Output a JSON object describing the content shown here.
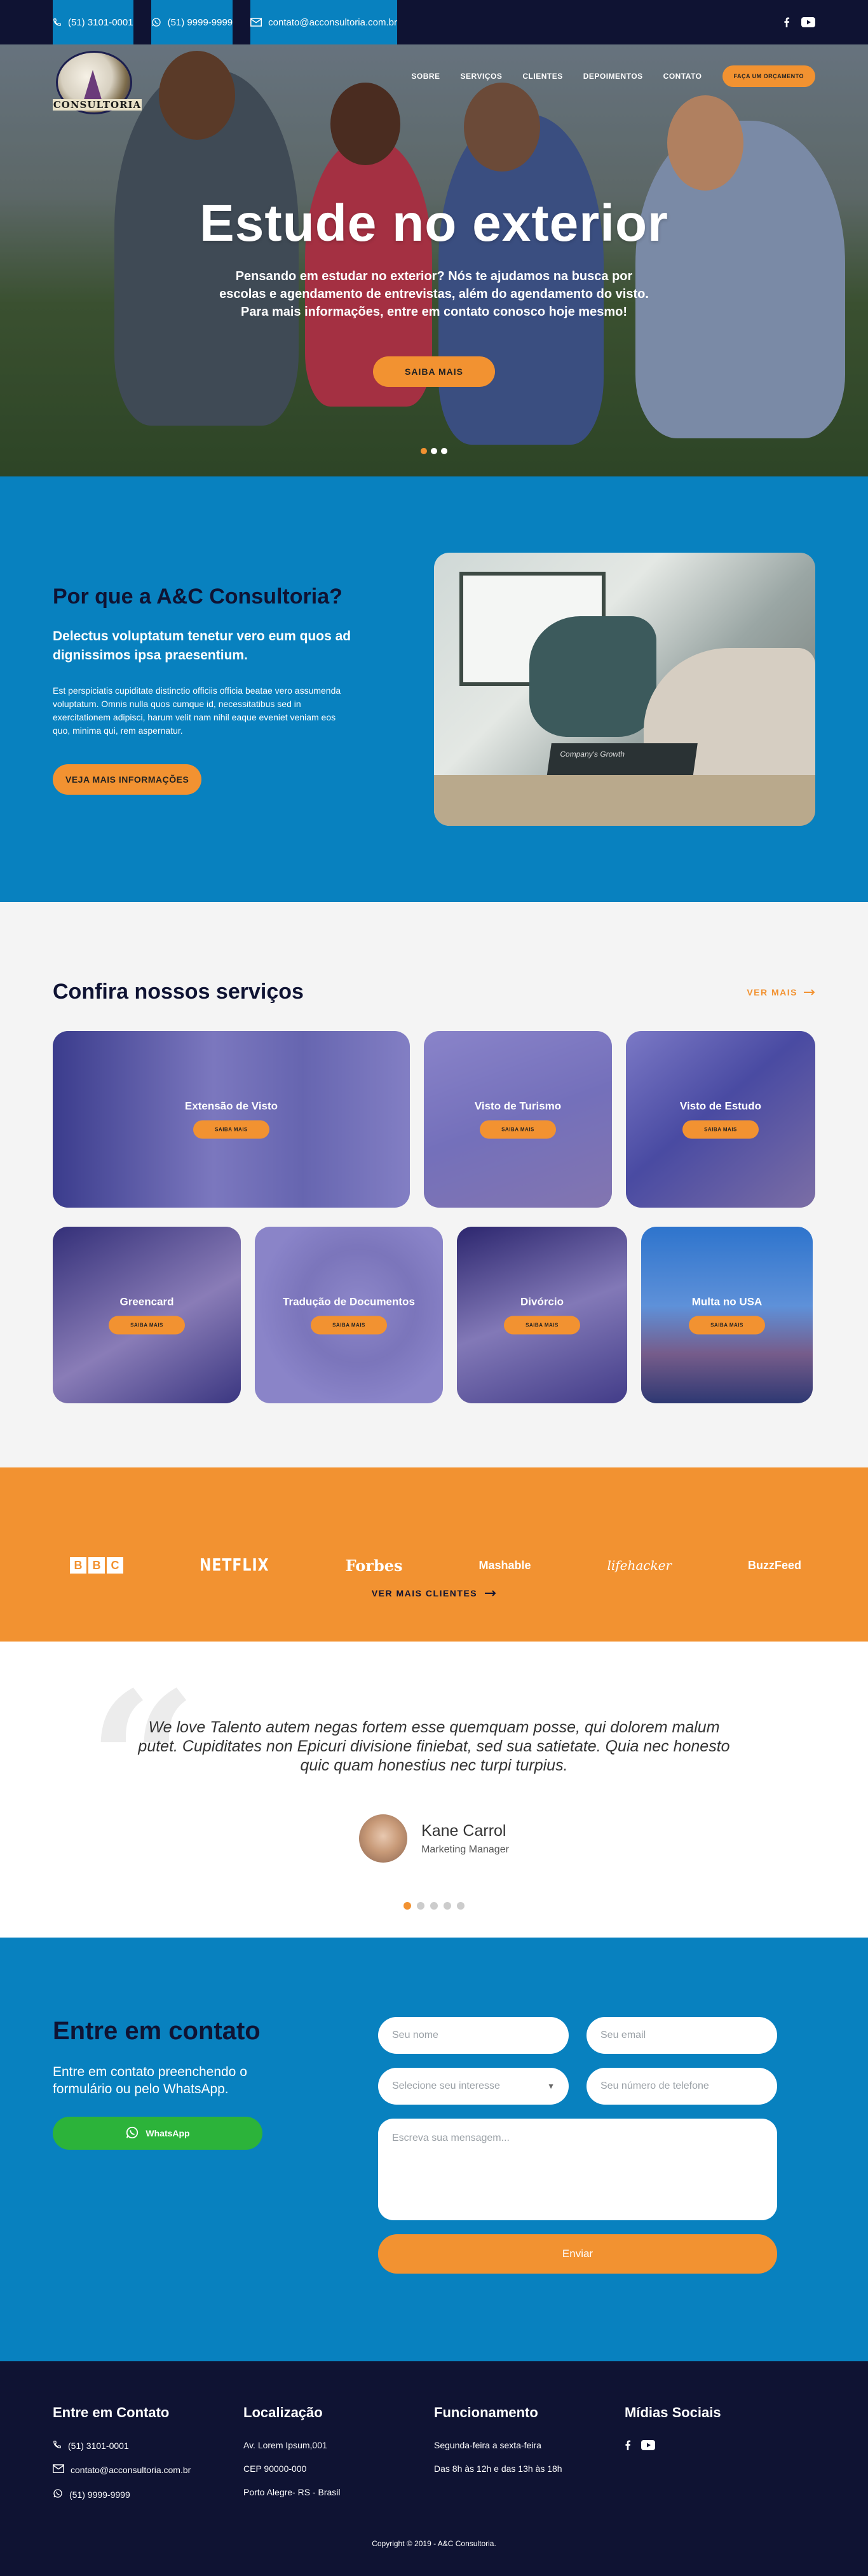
{
  "topbar": {
    "phone": "(51) 3101-0001",
    "whatsapp": "(51) 9999-9999",
    "email": "contato@acconsultoria.com.br"
  },
  "logo": {
    "wordmark": "CONSULTORIA"
  },
  "nav": {
    "items": [
      "SOBRE",
      "SERVIÇOS",
      "CLIENTES",
      "DEPOIMENTOS",
      "CONTATO"
    ],
    "cta": "FAÇA UM ORÇAMENTO"
  },
  "hero": {
    "title": "Estude no exterior",
    "text": "Pensando em estudar no exterior? Nós te ajudamos na busca por escolas e agendamento de entrevistas, além do agendamento do visto. Para mais informações, entre em contato conosco hoje mesmo!",
    "button": "SAIBA MAIS"
  },
  "why": {
    "title": "Por que a A&C Consultoria?",
    "lead": "Delectus voluptatum tenetur vero eum quos ad dignissimos ipsa praesentium.",
    "body": "Est perspiciatis cupiditate distinctio officiis officia beatae vero assumenda voluptatum. Omnis nulla quos cumque id, necessitatibus sed in exercitationem adipisci, harum velit nam nihil eaque eveniet veniam eos quo, minima qui, rem aspernatur.",
    "button": "VEJA MAIS INFORMAÇÕES",
    "photo_caption": "Company's Growth"
  },
  "services": {
    "title": "Confira nossos serviços",
    "see_more": "VER MAIS",
    "card_button": "SAIBA MAIS",
    "row1": [
      "Extensão de Visto",
      "Visto de Turismo",
      "Visto de Estudo"
    ],
    "row2": [
      "Greencard",
      "Tradução de Documentos",
      "Divórcio",
      "Multa no USA"
    ]
  },
  "clients": {
    "brands": [
      "NETFLIX",
      "Forbes",
      "Mashable",
      "lifehacker",
      "BuzzFeed"
    ],
    "bbc": [
      "B",
      "B",
      "C"
    ],
    "more": "VER MAIS CLIENTES"
  },
  "testimonial": {
    "quote": "We love Talento autem negas fortem esse quemquam posse, qui dolorem malum putet. Cupiditates non Epicuri divisione finiebat, sed sua satietate. Quia nec honesto quic quam honestius nec turpi turpius.",
    "name": "Kane Carrol",
    "role": "Marketing Manager"
  },
  "contact": {
    "title": "Entre em contato",
    "desc": "Entre em contato preenchendo o formulário ou pelo WhatsApp.",
    "whatsapp": "WhatsApp",
    "name_placeholder": "Seu nome",
    "email_placeholder": "Seu email",
    "interest_placeholder": "Selecione seu interesse",
    "phone_placeholder": "Seu número de telefone",
    "message_placeholder": "Escreva sua mensagem...",
    "submit": "Enviar"
  },
  "footer": {
    "contact_title": "Entre em Contato",
    "phone": "(51) 3101-0001",
    "email": "contato@acconsultoria.com.br",
    "whatsapp": "(51) 9999-9999",
    "location_title": "Localização",
    "address1": "Av. Lorem Ipsum,001",
    "address2": "CEP 90000-000",
    "address3": "Porto Alegre- RS - Brasil",
    "hours_title": "Funcionamento",
    "hours1": "Segunda-feira a sexta-feira",
    "hours2": "Das 8h às 12h e das 13h às 18h",
    "social_title": "Mídias Sociais",
    "copyright": "Copyright © 2019 - A&C Consultoria."
  },
  "colors": {
    "navy": "#0f1333",
    "blue": "#0881bf",
    "orange": "#f29231",
    "green": "#2cb33a"
  }
}
